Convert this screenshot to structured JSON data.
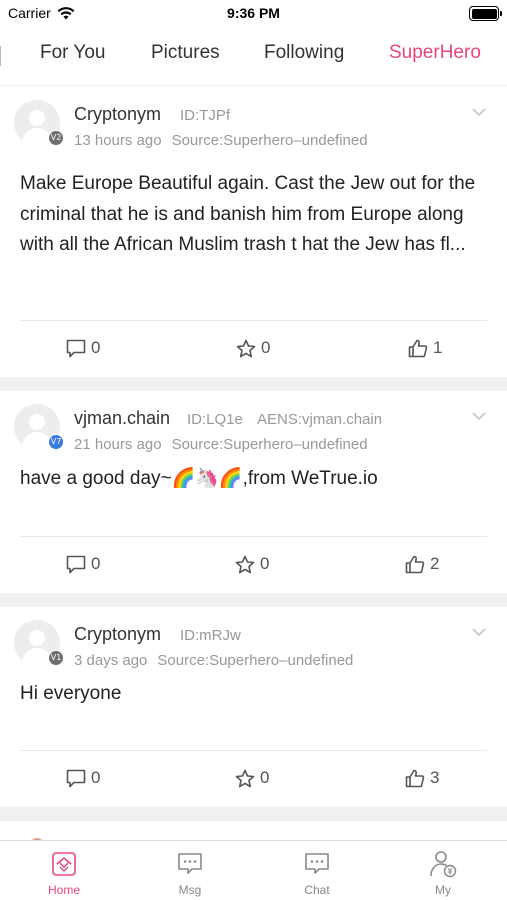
{
  "status": {
    "carrier": "Carrier",
    "time": "9:36 PM"
  },
  "tabs": [
    {
      "label": "For You",
      "active": false
    },
    {
      "label": "Pictures",
      "active": false
    },
    {
      "label": "Following",
      "active": false
    },
    {
      "label": "SuperHero",
      "active": true
    }
  ],
  "posts": [
    {
      "username": "Cryptonym",
      "id": "ID:TJPf",
      "aens": "",
      "badge": "V2",
      "time": "13 hours ago",
      "source": "Source:Superhero–undefined",
      "content": "Make Europe Beautiful again. Cast the Jew out for the criminal that he is and banish him from Europe along with all the African Muslim trash t hat the Jew has fl...",
      "comments": "0",
      "stars": "0",
      "likes": "1"
    },
    {
      "username": "vjman.chain",
      "id": "ID:LQ1e",
      "aens": "AENS:vjman.chain",
      "badge": "V7",
      "time": "21 hours ago",
      "source": "Source:Superhero–undefined",
      "content": "have a good day~🌈🦄🌈,from WeTrue.io",
      "comments": "0",
      "stars": "0",
      "likes": "2"
    },
    {
      "username": "Cryptonym",
      "id": "ID:mRJw",
      "aens": "",
      "badge": "V1",
      "time": "3 days ago",
      "source": "Source:Superhero–undefined",
      "content": "Hi everyone",
      "comments": "0",
      "stars": "0",
      "likes": "3"
    }
  ],
  "tabbar": [
    {
      "label": "Home",
      "icon": "home-icon",
      "active": true
    },
    {
      "label": "Msg",
      "icon": "message-icon",
      "active": false
    },
    {
      "label": "Chat",
      "icon": "chat-icon",
      "active": false
    },
    {
      "label": "My",
      "icon": "profile-icon",
      "active": false
    }
  ],
  "colors": {
    "accent": "#e8457e",
    "badge_blue": "#3a7be0",
    "badge_grey": "#6e6e6e",
    "separator": "#f0f0f0"
  }
}
